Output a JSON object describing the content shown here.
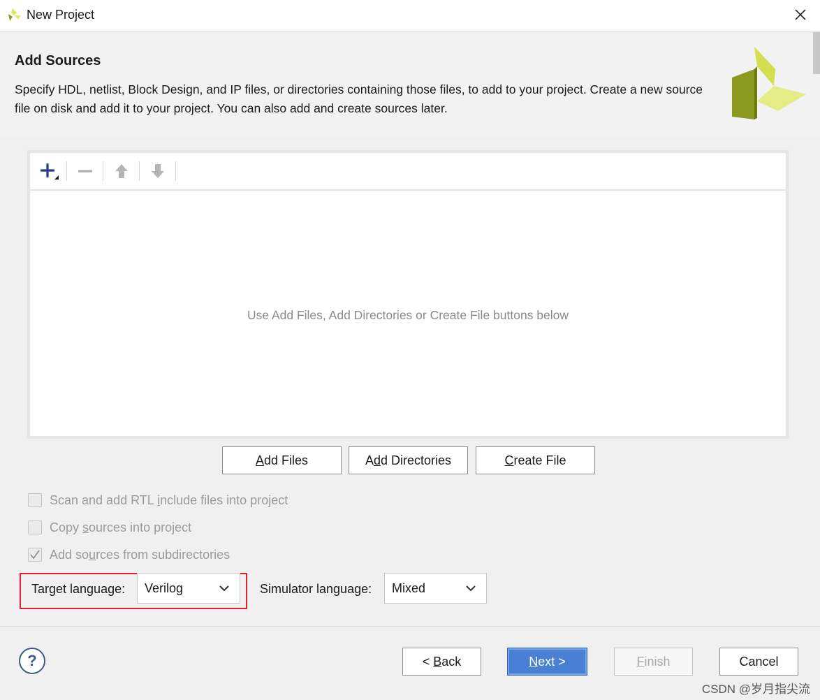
{
  "window": {
    "title": "New Project"
  },
  "header": {
    "heading": "Add Sources",
    "description": "Specify HDL, netlist, Block Design, and IP files, or directories containing those files, to add to your project. Create a new source file on disk and add it to your project. You can also add and create sources later."
  },
  "file_panel": {
    "empty_message": "Use Add Files, Add Directories or Create File buttons below"
  },
  "buttons": {
    "add_files": "Add Files",
    "add_directories": "Add Directories",
    "create_file": "Create File"
  },
  "options": [
    {
      "label": "Scan and add RTL include files into project",
      "checked": false,
      "enabled": false
    },
    {
      "label": "Copy sources into project",
      "checked": false,
      "enabled": false
    },
    {
      "label": "Add sources from subdirectories",
      "checked": true,
      "enabled": false
    }
  ],
  "target_language": {
    "label": "Target language:",
    "value": "Verilog"
  },
  "simulator_language": {
    "label": "Simulator language:",
    "value": "Mixed"
  },
  "footer": {
    "help": "?",
    "back": "< Back",
    "next": "Next >",
    "finish": "Finish",
    "cancel": "Cancel"
  },
  "watermark": "CSDN @岁月指尖流",
  "colors": {
    "accent": "#4a7fd6",
    "highlight_border": "#d9232e",
    "logo_light": "#d8e65a",
    "logo_dark": "#8a9a1e"
  }
}
